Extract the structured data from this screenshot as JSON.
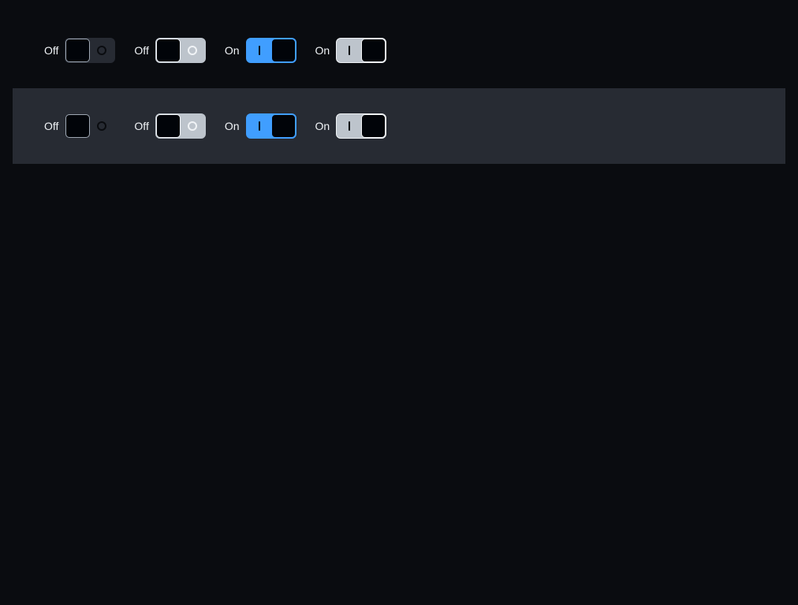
{
  "rows": [
    {
      "toggles": [
        {
          "label": "Off",
          "state": "off"
        },
        {
          "label": "Off",
          "state": "off"
        },
        {
          "label": "On",
          "state": "on"
        },
        {
          "label": "On",
          "state": "on"
        }
      ]
    },
    {
      "toggles": [
        {
          "label": "Off",
          "state": "off"
        },
        {
          "label": "Off",
          "state": "off"
        },
        {
          "label": "On",
          "state": "on"
        },
        {
          "label": "On",
          "state": "on"
        }
      ]
    }
  ],
  "colors": {
    "page_background": "#0a0c10",
    "band_background": "#272b33",
    "accent": "#409eff",
    "neutral_track": "#bdc4cc",
    "knob": "#010409",
    "label_text": "#f0f3f6"
  },
  "icons": {
    "off_indicator": "circle-icon",
    "on_indicator": "bar-icon"
  }
}
